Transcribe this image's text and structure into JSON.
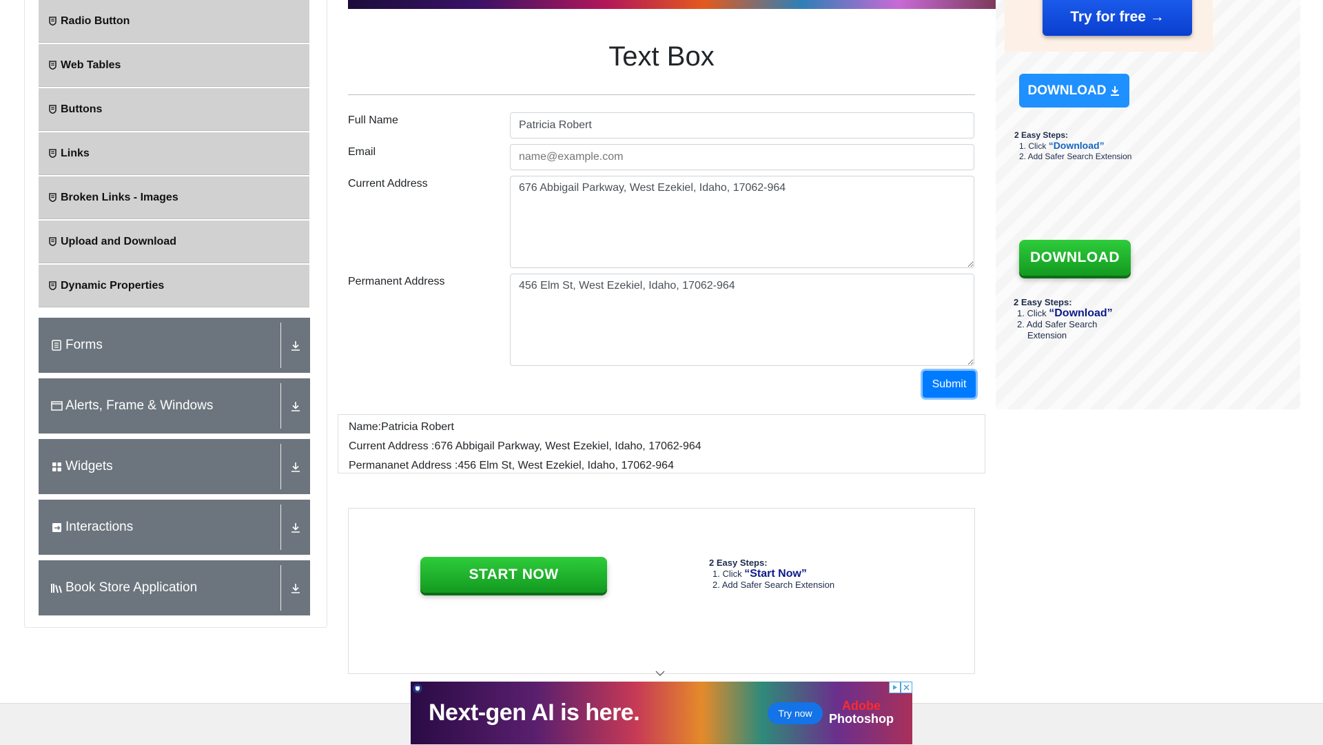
{
  "sidebar": {
    "sub_items": [
      {
        "label": "Radio Button",
        "icon": "shield-icon"
      },
      {
        "label": "Web Tables",
        "icon": "shield-icon"
      },
      {
        "label": "Buttons",
        "icon": "shield-icon"
      },
      {
        "label": "Links",
        "icon": "shield-icon"
      },
      {
        "label": "Broken Links - Images",
        "icon": "shield-icon"
      },
      {
        "label": "Upload and Download",
        "icon": "shield-icon"
      },
      {
        "label": "Dynamic Properties",
        "icon": "shield-icon"
      }
    ],
    "groups": [
      {
        "label": "Forms",
        "icon": "list-icon"
      },
      {
        "label": "Alerts, Frame & Windows",
        "icon": "window-icon"
      },
      {
        "label": "Widgets",
        "icon": "grid-icon"
      },
      {
        "label": "Interactions",
        "icon": "interactions-icon"
      },
      {
        "label": "Book Store Application",
        "icon": "books-icon"
      }
    ]
  },
  "main": {
    "title": "Text Box",
    "form": {
      "full_name_label": "Full Name",
      "full_name_value": "Patricia Robert",
      "email_label": "Email",
      "email_placeholder": "name@example.com",
      "current_address_label": "Current Address",
      "current_address_value": "676 Abbigail Parkway, West Ezekiel, Idaho, 17062-964",
      "permanent_address_label": "Permanent Address",
      "permanent_address_value": "456 Elm St, West Ezekiel, Idaho, 17062-964",
      "submit_label": "Submit"
    },
    "output": {
      "name": "Name:Patricia Robert",
      "current_address": "Current Address :676 Abbigail Parkway, West Ezekiel, Idaho, 17062-964",
      "permanent_address": "Permananet Address :456 Elm St, West Ezekiel, Idaho, 17062-964"
    }
  },
  "mid_ad": {
    "button_label": "START NOW",
    "steps_title": "2 Easy Steps:",
    "step1_prefix": "1. Click ",
    "step1_highlight": "“Start Now”",
    "step2": "2. Add Safer Search Extension"
  },
  "right_ad": {
    "try_free_label": "Try for free →",
    "download_blue_label": "DOWNLOAD",
    "steps1_title": "2 Easy Steps:",
    "steps1_step1_prefix": "1. Click ",
    "steps1_step1_highlight": "“Download”",
    "steps1_step2": "2. Add Safer Search Extension",
    "download_green_label": "DOWNLOAD",
    "steps2_title": "2 Easy Steps:",
    "steps2_step1_prefix": "1. Click ",
    "steps2_step1_highlight": "“Download”",
    "steps2_step2_line1": "2. Add Safer Search",
    "steps2_step2_line2": "Extension"
  },
  "bottom_ad": {
    "headline": "Next-gen AI is here.",
    "try_label": "Try now",
    "brand_line1": "Adobe",
    "brand_line2": "Photoshop"
  },
  "colors": {
    "sidebar_item_bg": "#d1d1d1",
    "group_bg": "#6c757d",
    "primary": "#007bff",
    "green_button": "#1fb02c"
  }
}
